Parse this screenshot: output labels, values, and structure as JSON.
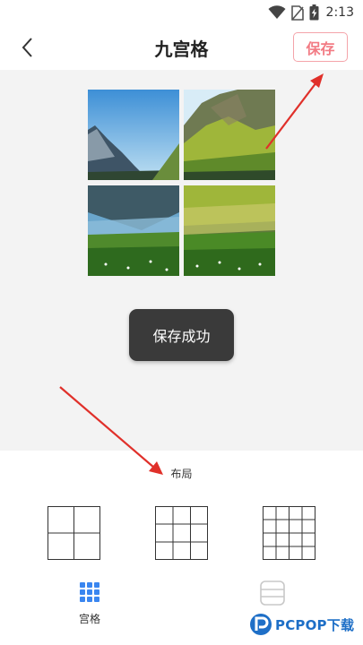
{
  "status_bar": {
    "time": "2:13"
  },
  "header": {
    "title": "九宫格",
    "save_label": "保存"
  },
  "toast": {
    "text": "保存成功"
  },
  "layout": {
    "label": "布局",
    "options": [
      "2x2",
      "3x3",
      "4x4"
    ]
  },
  "bottom_nav": {
    "items": [
      {
        "label": "宫格",
        "icon": "grid-icon"
      },
      {
        "label": "",
        "icon": "rows-icon"
      }
    ]
  },
  "watermark": {
    "text": "PCPOP下载"
  },
  "colors": {
    "save_accent": "#f27b84",
    "arrow": "#e0302a",
    "toast_bg": "#3a3a3a",
    "nav_active": "#3a86f0"
  }
}
